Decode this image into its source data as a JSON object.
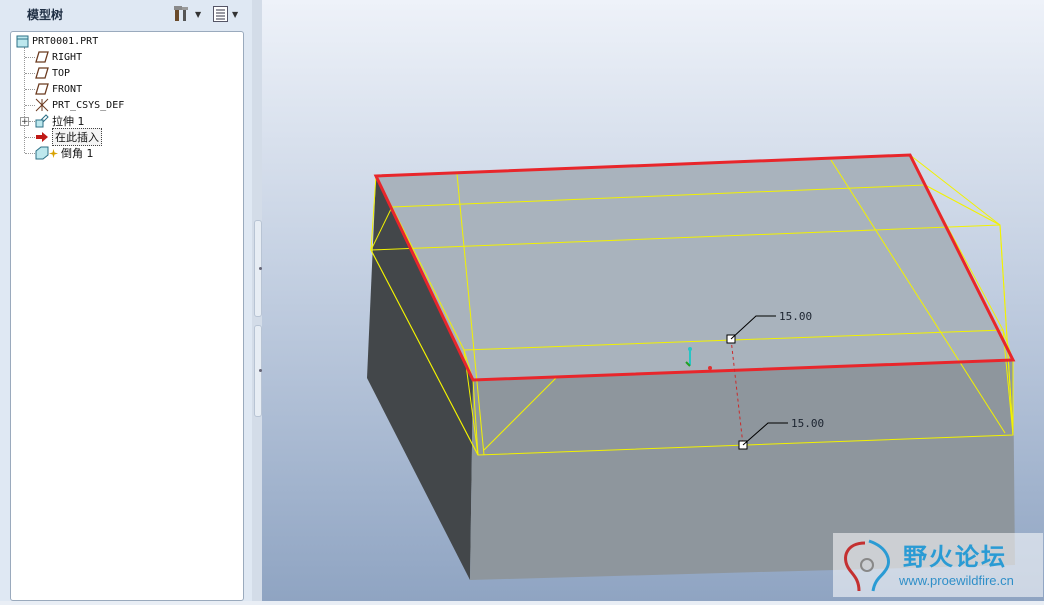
{
  "model_tree": {
    "title": "模型树",
    "items": [
      {
        "label": "PRT0001.PRT",
        "icon": "part-icon"
      },
      {
        "label": "RIGHT",
        "icon": "datum-plane-icon"
      },
      {
        "label": "TOP",
        "icon": "datum-plane-icon"
      },
      {
        "label": "FRONT",
        "icon": "datum-plane-icon"
      },
      {
        "label": "PRT_CSYS_DEF",
        "icon": "coordinate-system-icon"
      },
      {
        "label": "拉伸 1",
        "icon": "extrude-icon"
      },
      {
        "label": "在此插入",
        "icon": "insert-arrow-icon"
      },
      {
        "label": "倒角 1",
        "icon": "chamfer-icon"
      }
    ]
  },
  "viewport": {
    "dimension_top": "15.00",
    "dimension_bottom": "15.00"
  },
  "watermark": {
    "title": "野火论坛",
    "url": "www.proewildfire.cn"
  },
  "colors": {
    "edge_highlight": "#e8262b",
    "preview_edges": "#f2f200",
    "solid_side_dark": "#43474a",
    "solid_side_light": "#8e969d",
    "solid_top": "#a9b3bd"
  }
}
